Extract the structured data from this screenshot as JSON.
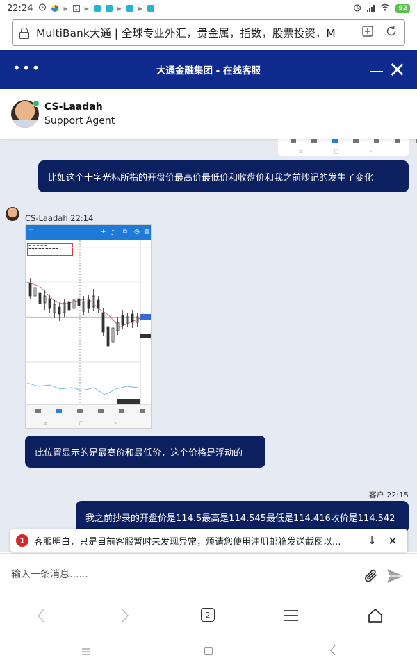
{
  "status_bar": {
    "time": "22:24",
    "battery": "92"
  },
  "browser": {
    "url_text": "MultiBank大通 | 全球专业外汇，贵金属，指数，股票投资，M",
    "tab_count": "2"
  },
  "chat_header": {
    "title": "大通金融集团 - 在线客服"
  },
  "agent": {
    "name": "CS-Laadah",
    "role": "Support Agent"
  },
  "messages": [
    {
      "side": "right",
      "text": "比如这个十字光标所指的开盘价最高价最低价和收盘价和我之前炒记的发生了变化"
    },
    {
      "side": "left",
      "meta": "CS-Laadah 22:14",
      "type": "image"
    },
    {
      "side": "left",
      "text": "此位置显示的是最高价和最低价，这个价格是浮动的"
    },
    {
      "side": "right",
      "meta": "客户 22:15",
      "text": "我之前抄录的开盘价是114.5最高是114.545最低是114.416收价是114.542"
    }
  ],
  "notification": {
    "count": "1",
    "text": "客服明白，只是目前客服暂时未发现异常，烦请您使用注册邮箱发送截图以..."
  },
  "composer": {
    "placeholder": "输入一条消息......"
  },
  "colors": {
    "header_bg": "#0d2a8c",
    "bubble_bg": "#0c1f5e",
    "chat_bg": "#e5eaf3",
    "badge_red": "#d62828",
    "online_green": "#2eb872"
  }
}
